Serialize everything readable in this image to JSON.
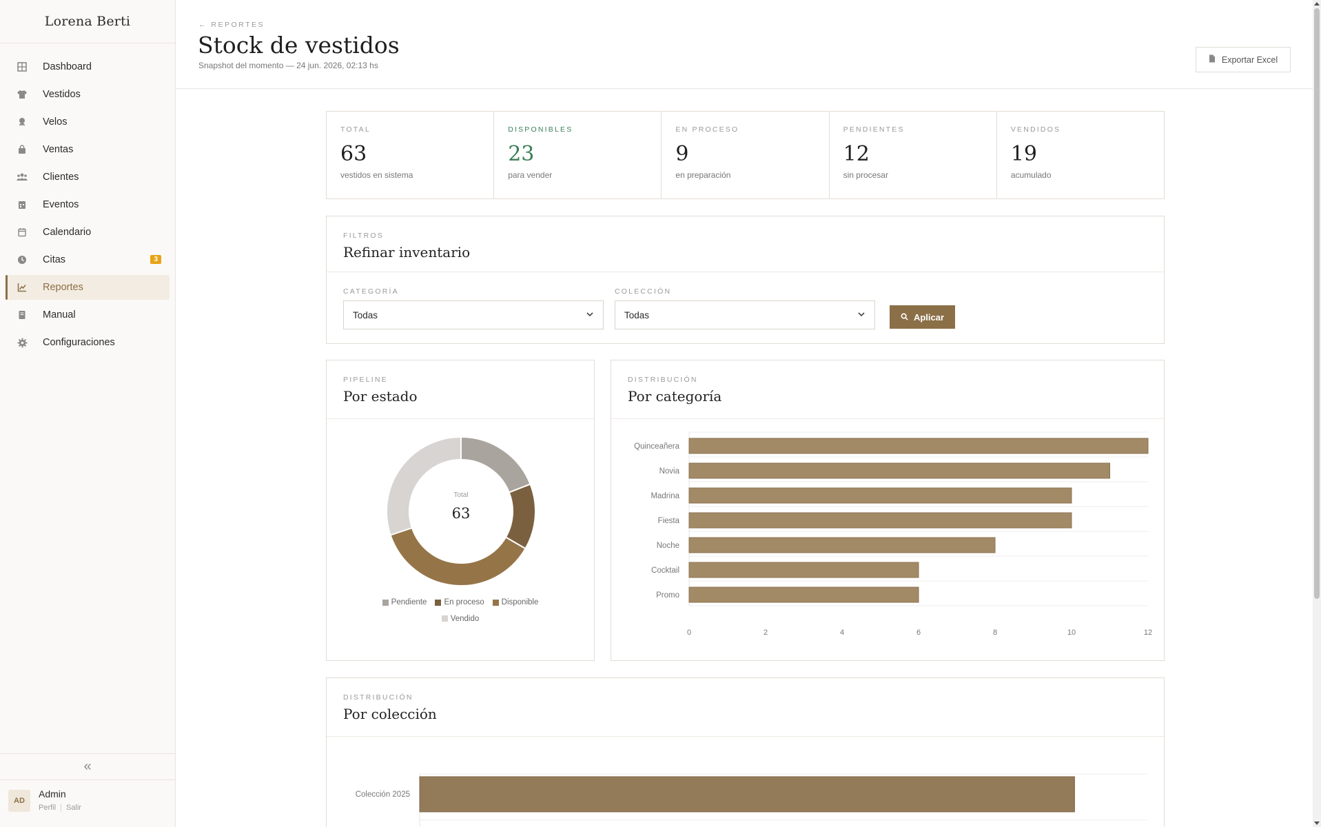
{
  "sidebar": {
    "brand": "Lorena Berti",
    "items": [
      {
        "label": "Dashboard",
        "icon": "grid-icon"
      },
      {
        "label": "Vestidos",
        "icon": "shirt-icon"
      },
      {
        "label": "Velos",
        "icon": "veil-icon"
      },
      {
        "label": "Ventas",
        "icon": "bag-icon"
      },
      {
        "label": "Clientes",
        "icon": "users-icon"
      },
      {
        "label": "Eventos",
        "icon": "calendar-days-icon"
      },
      {
        "label": "Calendario",
        "icon": "calendar-icon"
      },
      {
        "label": "Citas",
        "icon": "clock-icon",
        "badge": "3"
      },
      {
        "label": "Reportes",
        "icon": "chart-line-icon",
        "active": true
      },
      {
        "label": "Manual",
        "icon": "book-icon"
      },
      {
        "label": "Configuraciones",
        "icon": "gear-icon"
      }
    ],
    "collapse_icon": "double-chevron-left-icon",
    "user": {
      "initials": "AD",
      "name": "Admin",
      "profile": "Perfil",
      "logout": "Salir"
    }
  },
  "header": {
    "breadcrumb": "REPORTES",
    "title": "Stock de vestidos",
    "subtitle": "Snapshot del momento — 24 jun. 2026, 02:13 hs",
    "export_label": "Exportar Excel"
  },
  "stats": [
    {
      "label": "TOTAL",
      "value": "63",
      "desc": "vestidos en sistema"
    },
    {
      "label": "DISPONIBLES",
      "value": "23",
      "desc": "para vender",
      "accent": "#3a7d55"
    },
    {
      "label": "EN PROCESO",
      "value": "9",
      "desc": "en preparación"
    },
    {
      "label": "PENDIENTES",
      "value": "12",
      "desc": "sin procesar"
    },
    {
      "label": "VENDIDOS",
      "value": "19",
      "desc": "acumulado"
    }
  ],
  "filters": {
    "section": "FILTROS",
    "title": "Refinar inventario",
    "category_label": "CATEGORÍA",
    "category_value": "Todas",
    "collection_label": "COLECCIÓN",
    "collection_value": "Todas",
    "apply_label": "Aplicar"
  },
  "pie_card": {
    "section": "PIPELINE",
    "title": "Por estado",
    "center_label": "Total",
    "center_value": "63"
  },
  "bar_card": {
    "section": "DISTRIBUCIÓN",
    "title": "Por categoría"
  },
  "col_card": {
    "section": "DISTRIBUCIÓN",
    "title": "Por colección"
  },
  "colors": {
    "accent": "#8b6f47",
    "bar": "#a38a66",
    "green": "#3a7d55",
    "badge": "#e8a317"
  },
  "chart_data": [
    {
      "type": "pie",
      "donut": true,
      "title": "Por estado",
      "categories": [
        "Pendiente",
        "En proceso",
        "Disponible",
        "Vendido"
      ],
      "values": [
        12,
        9,
        23,
        19
      ],
      "colors": [
        "#aaa49e",
        "#7b6040",
        "#957548",
        "#d7d4d1"
      ],
      "legend": "bottom"
    },
    {
      "type": "bar",
      "orientation": "horizontal",
      "title": "Por categoría",
      "categories": [
        "Quinceañera",
        "Novia",
        "Madrina",
        "Fiesta",
        "Noche",
        "Cocktail",
        "Promo"
      ],
      "values": [
        12,
        11,
        10,
        10,
        8,
        6,
        6
      ],
      "xlim": [
        0,
        12
      ],
      "xticks": [
        "0",
        "2",
        "4",
        "6",
        "8",
        "10",
        "12"
      ],
      "grid": true
    },
    {
      "type": "bar",
      "orientation": "horizontal",
      "title": "Por colección",
      "categories": [
        "Colección 2025"
      ],
      "values": [
        63
      ],
      "xlim": [
        0,
        70
      ],
      "grid": true
    }
  ]
}
